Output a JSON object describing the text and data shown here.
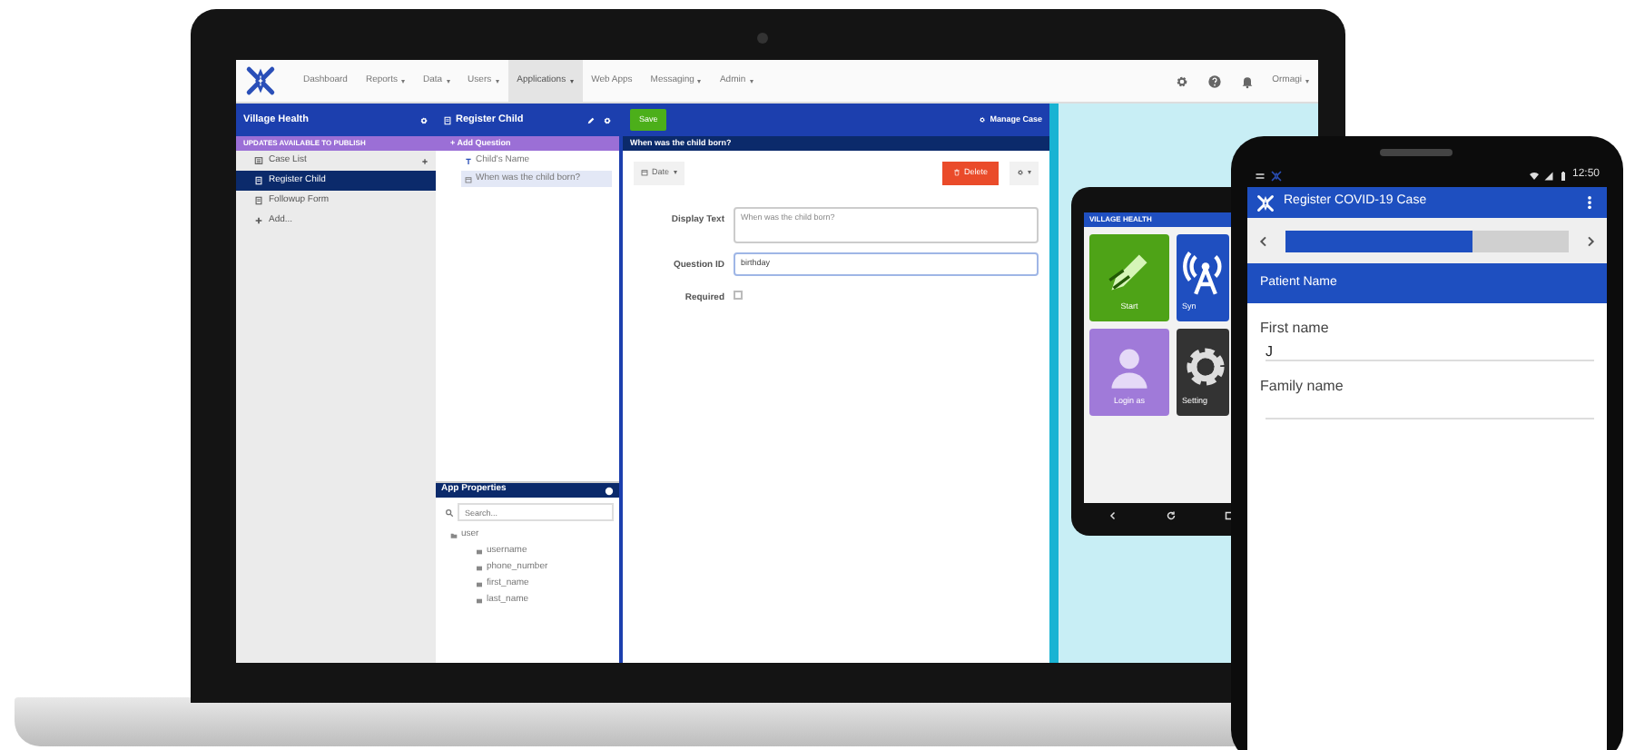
{
  "laptop": {
    "navbar": {
      "items": [
        {
          "label": "Dashboard",
          "selected": false,
          "dropdown": false
        },
        {
          "label": "Reports",
          "selected": false,
          "dropdown": true
        },
        {
          "label": "Data",
          "selected": false,
          "dropdown": true
        },
        {
          "label": "Users",
          "selected": false,
          "dropdown": true
        },
        {
          "label": "Applications",
          "selected": true,
          "dropdown": true
        },
        {
          "label": "Web Apps",
          "selected": false,
          "dropdown": false
        },
        {
          "label": "Messaging",
          "selected": false,
          "dropdown": true
        },
        {
          "label": "Admin",
          "selected": false,
          "dropdown": true
        }
      ],
      "user": "Ormagi"
    },
    "app_sidebar": {
      "title": "Village Health",
      "notice": "UPDATES AVAILABLE TO PUBLISH",
      "items": [
        {
          "label": "Case List",
          "kind": "case-list",
          "selected": false
        },
        {
          "label": "Register Child",
          "kind": "form",
          "selected": true
        },
        {
          "label": "Followup Form",
          "kind": "form",
          "selected": false
        },
        {
          "label": "Add...",
          "kind": "add",
          "selected": false
        }
      ]
    },
    "form_panel": {
      "title": "Register Child",
      "add_button": "+ Add Question",
      "questions": [
        {
          "label": "Child's Name",
          "kind": "text",
          "selected": false
        },
        {
          "label": "When was the child born?",
          "kind": "date",
          "selected": true
        }
      ]
    },
    "app_properties": {
      "title": "App Properties",
      "search_placeholder": "Search...",
      "tree": [
        {
          "label": "user",
          "children": [
            {
              "label": "username"
            },
            {
              "label": "phone_number"
            },
            {
              "label": "first_name"
            },
            {
              "label": "last_name"
            }
          ]
        }
      ]
    },
    "editor": {
      "save": "Save",
      "manage": "Manage Case",
      "question_title": "When was the child born?",
      "type_button": "Date",
      "delete": "Delete",
      "fields": [
        {
          "label": "Display Text",
          "kind": "textarea",
          "value": "When was the child born?"
        },
        {
          "label": "Question ID",
          "kind": "input",
          "value": "birthday"
        },
        {
          "label": "Required",
          "kind": "checkbox",
          "checked": false
        }
      ]
    },
    "tablet": {
      "title": "VILLAGE HEALTH",
      "tiles": [
        {
          "label": "Start",
          "kind": "pencil",
          "color": "#4ea317"
        },
        {
          "label": "Syn",
          "kind": "antenna",
          "color": "#1f4fc0"
        },
        {
          "label": "Login as",
          "kind": "person",
          "color": "#a07ad9"
        },
        {
          "label": "Setting",
          "kind": "gear",
          "color": "#333333"
        }
      ]
    }
  },
  "phone": {
    "status_time": "12:50",
    "title": "Register COVID-19 Case",
    "progress": {
      "level": 0.66
    },
    "section": "Patient Name",
    "fields": [
      {
        "label": "First name",
        "value": "J"
      },
      {
        "label": "Family name"
      }
    ]
  }
}
